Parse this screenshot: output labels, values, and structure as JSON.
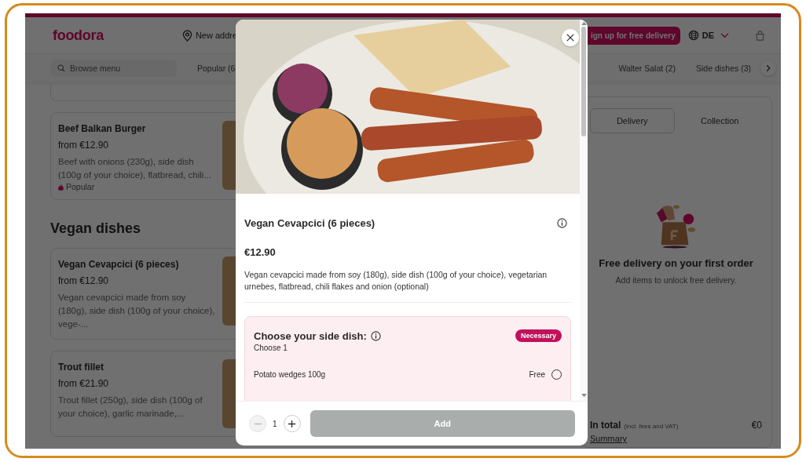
{
  "header": {
    "logo": "foodora",
    "address": "New addre",
    "signup_button": "ign up for free delivery",
    "language": "DE"
  },
  "category_bar": {
    "search": {
      "placeholder": "Browse menu"
    },
    "left_categories": [
      "Popular (6"
    ],
    "right_categories": [
      "Walter Salat (2)",
      "Side dishes (3)"
    ]
  },
  "menu": {
    "top_items": [
      {
        "name": "Beef Balkan Burger",
        "price": "from €12.90",
        "description": "Beef with onions (230g), side dish (100g of your choice), flatbread, chili...",
        "tag": "Popular"
      }
    ],
    "sections": [
      {
        "title": "Vegan dishes",
        "items": [
          {
            "name": "Vegan Cevapcici (6 pieces)",
            "price": "from €12.90",
            "description": "Vegan cevapcici made from soy (180g), side dish (100g of your choice), vege-..."
          },
          {
            "name": "Trout fillet",
            "price": "from €21.90",
            "description": "Trout fillet (250g), side dish (100g of your choice), garlic marinade,..."
          }
        ]
      }
    ]
  },
  "cart": {
    "modes": [
      {
        "label": "Delivery",
        "selected": true
      },
      {
        "label": "Collection",
        "selected": false
      }
    ],
    "promo_title": "Free delivery on your first order",
    "promo_text": "Add items to unlock free delivery.",
    "total_label": "In total",
    "total_note": "(incl. fees and VAT)",
    "total": "€0",
    "summary_link": "Summary"
  },
  "modal": {
    "title": "Vegan Cevapcici (6 pieces)",
    "price": "€12.90",
    "description": "Vegan cevapcici made from soy (180g), side dish (100g of your choice), vegetarian urnebes, flatbread, chili flakes and onion (optional)",
    "option_group": {
      "title": "Choose your side dish:",
      "badge": "Necessary",
      "hint": "Choose 1",
      "options": [
        {
          "label": "Potato wedges 100g",
          "price": "Free",
          "selected": false
        }
      ]
    },
    "quantity": "1",
    "decrease_disabled": true,
    "add_button": {
      "label": "Add",
      "disabled": true
    }
  }
}
